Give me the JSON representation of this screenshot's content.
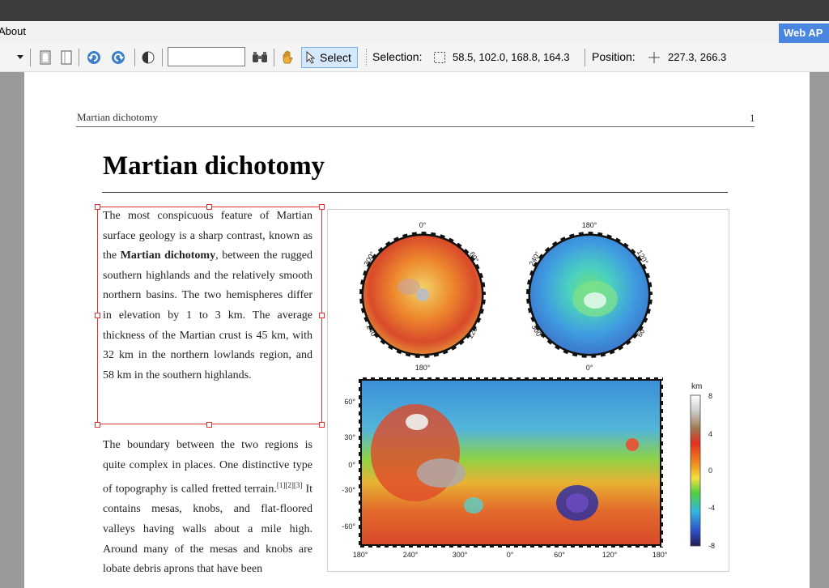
{
  "menubar": {
    "about_label": "About",
    "webapi_label": "Web AP"
  },
  "toolbar": {
    "find_value": "",
    "select_label": "Select",
    "selection_label": "Selection:",
    "selection_value": "58.5, 102.0, 168.8, 164.3",
    "position_label": "Position:",
    "position_value": "227.3, 266.3"
  },
  "document": {
    "running_head": "Martian dichotomy",
    "page_number": "1",
    "title": "Martian dichotomy",
    "para1": {
      "pre": "The most conspicuous feature of Martian surface geology is a sharp contrast, known as the ",
      "bold": "Martian dichotomy",
      "post": ", between the rugged southern highlands and the relatively smooth northern basins. The two hemispheres differ in elevation by 1 to 3 km. The average thickness of the Martian crust is 45 km, with 32 km in the northern lowlands region, and 58 km in the southern highlands."
    },
    "para2": {
      "pre": "The boundary between the two regions is quite complex in places. One distinctive type of topography is called fretted terrain.",
      "refs": "[1][2][3]",
      "post": " It contains mesas, knobs, and flat-floored valleys having walls about a mile high. Around many of the mesas and knobs are lobate debris aprons that have been"
    }
  },
  "figure": {
    "north_pole_labels": [
      "0°",
      "60°",
      "120°",
      "180°",
      "240°",
      "300°"
    ],
    "south_pole_labels": [
      "180°",
      "120°",
      "60°",
      "0°",
      "300°",
      "240°"
    ],
    "lat_labels": [
      "60°",
      "30°",
      "0°",
      "-30°",
      "-60°"
    ],
    "lon_labels": [
      "180°",
      "240°",
      "300°",
      "0°",
      "60°",
      "120°",
      "180°"
    ],
    "colorbar_unit": "km",
    "colorbar_ticks": [
      "8",
      "4",
      "0",
      "-4",
      "-8"
    ],
    "colors": {
      "highland": "#d8522a",
      "lowland": "#3f9be0",
      "mid": "#7ccd3c"
    }
  }
}
